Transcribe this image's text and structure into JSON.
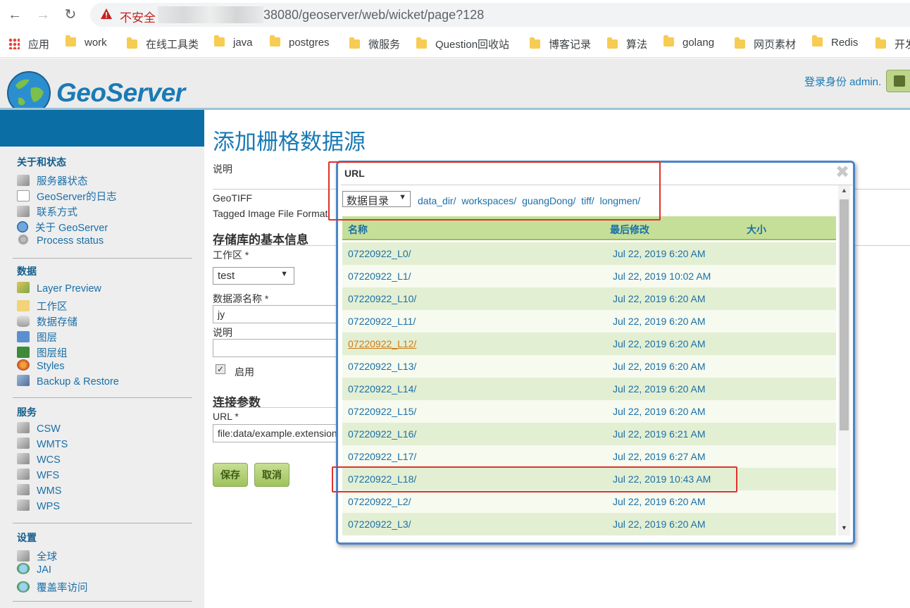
{
  "browser": {
    "insecure_label": "不安全",
    "url": "38080/geoserver/web/wicket/page?128",
    "bookmarks": [
      "应用",
      "work",
      "在线工具类",
      "java",
      "postgres",
      "微服务",
      "Question回收站",
      "博客记录",
      "算法",
      "golang",
      "网页素材",
      "Redis",
      "开发"
    ]
  },
  "header": {
    "logo_text": "GeoServer",
    "login_label": "登录身份 admin."
  },
  "sidebar": {
    "sections": [
      {
        "title": "关于和状态",
        "items": [
          {
            "label": "服务器状态",
            "icon": "server-icon"
          },
          {
            "label": "GeoServer的日志",
            "icon": "log-icon"
          },
          {
            "label": "联系方式",
            "icon": "contact-icon"
          },
          {
            "label": "关于 GeoServer",
            "icon": "info-icon"
          },
          {
            "label": "Process status",
            "icon": "gear-icon"
          }
        ]
      },
      {
        "title": "数据",
        "items": [
          {
            "label": "Layer Preview",
            "icon": "map-icon"
          },
          {
            "label": "工作区",
            "icon": "folder-icon"
          },
          {
            "label": "数据存储",
            "icon": "database-icon"
          },
          {
            "label": "图层",
            "icon": "layer-icon"
          },
          {
            "label": "图层组",
            "icon": "layer-group-icon"
          },
          {
            "label": "Styles",
            "icon": "palette-icon"
          },
          {
            "label": "Backup & Restore",
            "icon": "backup-icon"
          }
        ]
      },
      {
        "title": "服务",
        "items": [
          {
            "label": "CSW",
            "icon": "service-icon"
          },
          {
            "label": "WMTS",
            "icon": "service-icon"
          },
          {
            "label": "WCS",
            "icon": "service-icon"
          },
          {
            "label": "WFS",
            "icon": "service-icon"
          },
          {
            "label": "WMS",
            "icon": "service-icon"
          },
          {
            "label": "WPS",
            "icon": "service-icon"
          }
        ]
      },
      {
        "title": "设置",
        "items": [
          {
            "label": "全球",
            "icon": "server-icon"
          },
          {
            "label": "JAI",
            "icon": "jai-icon"
          },
          {
            "label": "覆盖率访问",
            "icon": "coverage-icon"
          }
        ]
      }
    ]
  },
  "main": {
    "page_title": "添加栅格数据源",
    "description_label": "说明",
    "type_name": "GeoTIFF",
    "type_description": "Tagged Image File Format",
    "basic_info_title": "存储库的基本信息",
    "workspace_label": "工作区 *",
    "workspace_value": "test",
    "datasource_name_label": "数据源名称 *",
    "datasource_name_value": "jy",
    "desc_label": "说明",
    "desc_value": "",
    "enabled_label": "启用",
    "connection_title": "连接参数",
    "url_label": "URL *",
    "url_value": "file:data/example.extension",
    "save_label": "保存",
    "cancel_label": "取消"
  },
  "dialog": {
    "title": "URL",
    "root_select": "数据目录",
    "breadcrumb": [
      "data_dir/",
      "workspaces/",
      "guangDong/",
      "tiff/",
      "longmen/"
    ],
    "columns": {
      "name": "名称",
      "modified": "最后修改",
      "size": "大小"
    },
    "rows": [
      {
        "name": "07220922_L0/",
        "modified": "Jul 22, 2019 6:20 AM"
      },
      {
        "name": "07220922_L1/",
        "modified": "Jul 22, 2019 10:02 AM"
      },
      {
        "name": "07220922_L10/",
        "modified": "Jul 22, 2019 6:20 AM"
      },
      {
        "name": "07220922_L11/",
        "modified": "Jul 22, 2019 6:20 AM"
      },
      {
        "name": "07220922_L12/",
        "modified": "Jul 22, 2019 6:20 AM",
        "visited": true
      },
      {
        "name": "07220922_L13/",
        "modified": "Jul 22, 2019 6:20 AM"
      },
      {
        "name": "07220922_L14/",
        "modified": "Jul 22, 2019 6:20 AM"
      },
      {
        "name": "07220922_L15/",
        "modified": "Jul 22, 2019 6:20 AM"
      },
      {
        "name": "07220922_L16/",
        "modified": "Jul 22, 2019 6:21 AM"
      },
      {
        "name": "07220922_L17/",
        "modified": "Jul 22, 2019 6:27 AM"
      },
      {
        "name": "07220922_L18/",
        "modified": "Jul 22, 2019 10:43 AM"
      },
      {
        "name": "07220922_L2/",
        "modified": "Jul 22, 2019 6:20 AM"
      },
      {
        "name": "07220922_L3/",
        "modified": "Jul 22, 2019 6:20 AM"
      }
    ]
  },
  "colors": {
    "accent": "#1a7ab5",
    "sidebar_band": "#0b6ea4",
    "row_odd": "#e3efd3",
    "row_even": "#f6faef",
    "highlight": "#e0322b",
    "button": "#9fc35c"
  }
}
